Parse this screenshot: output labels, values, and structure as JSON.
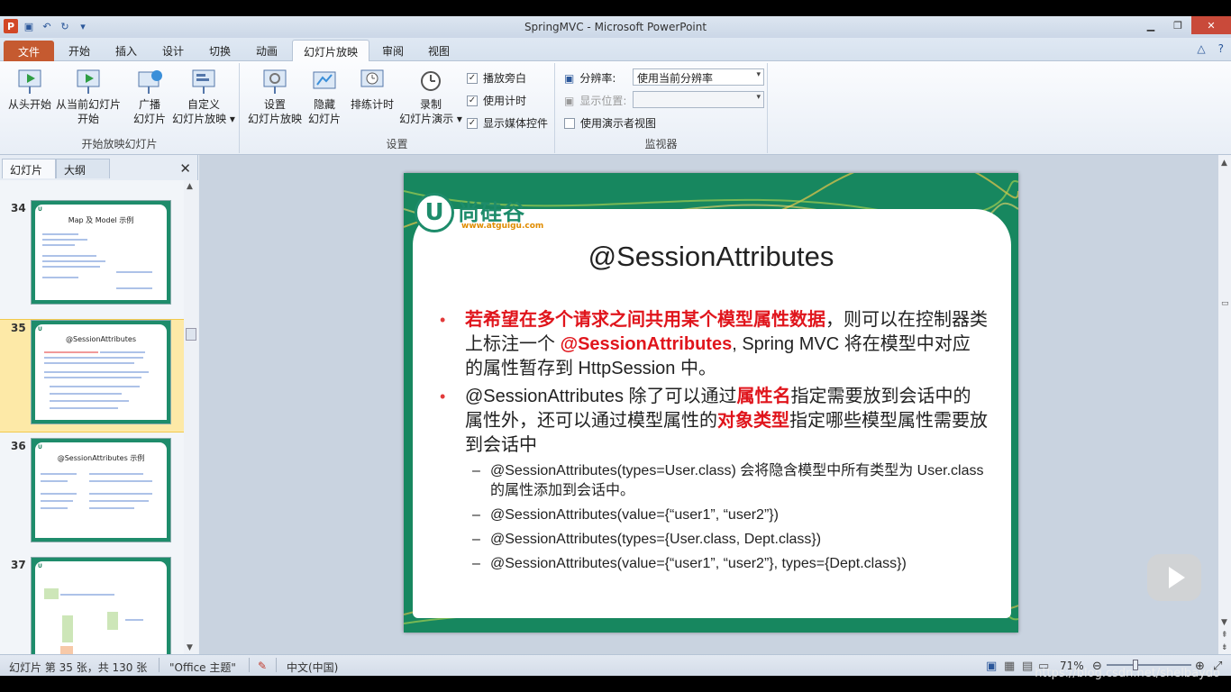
{
  "app": {
    "title": "SpringMVC  -  Microsoft PowerPoint",
    "qat_icons": [
      "powerpoint-icon",
      "save-icon",
      "undo-icon",
      "redo-icon",
      "customize-icon"
    ]
  },
  "tabs": [
    "文件",
    "开始",
    "插入",
    "设计",
    "切换",
    "动画",
    "幻灯片放映",
    "审阅",
    "视图"
  ],
  "ribbon": {
    "group1": {
      "label": "开始放映幻灯片",
      "btn1": "从头开始",
      "btn2_l1": "从当前幻灯片",
      "btn2_l2": "开始",
      "btn3_l1": "广播",
      "btn3_l2": "幻灯片",
      "btn4_l1": "自定义",
      "btn4_l2": "幻灯片放映 ▾"
    },
    "group2": {
      "label": "设置",
      "btn1_l1": "设置",
      "btn1_l2": "幻灯片放映",
      "btn2_l1": "隐藏",
      "btn2_l2": "幻灯片",
      "btn3": "排练计时",
      "btn4_l1": "录制",
      "btn4_l2": "幻灯片演示 ▾",
      "chk1": "播放旁白",
      "chk2": "使用计时",
      "chk3": "显示媒体控件"
    },
    "group3": {
      "label": "监视器",
      "resolution_label": "分辨率:",
      "resolution_value": "使用当前分辨率",
      "display_label": "显示位置:",
      "presenter": "使用演示者视图"
    }
  },
  "pane": {
    "tab_slides": "幻灯片",
    "tab_outline": "大纲",
    "close": "✕",
    "thumbs": [
      {
        "num": "34",
        "title": "Map 及 Model 示例"
      },
      {
        "num": "35",
        "title": "@SessionAttributes"
      },
      {
        "num": "36",
        "title": "@SessionAttributes 示例"
      },
      {
        "num": "37",
        "title": ""
      }
    ]
  },
  "slide": {
    "logo_letter": "U",
    "logo_name": "尚硅谷",
    "logo_url": "www.atguigu.com",
    "title": "@SessionAttributes",
    "p1_red": "若希望在多个请求之间共用某个模型属性数据",
    "p1_a": "，则可以在控制器类上标注一个 ",
    "p1_red2": "@SessionAttributes",
    "p1_b": ", Spring MVC 将在模型中对应的属性暂存到 HttpSession 中。",
    "p2_a": "@SessionAttributes 除了可以通过",
    "p2_red": "属性名",
    "p2_b": "指定需要放到会话中的属性外，还可以通过模型属性的",
    "p2_red2": "对象类型",
    "p2_c": "指定哪些模型属性需要放到会话中",
    "s1": "@SessionAttributes(types=User.class) 会将隐含模型中所有类型为 User.class 的属性添加到会话中。",
    "s2": "@SessionAttributes(value={“user1”, “user2”})",
    "s3": "@SessionAttributes(types={User.class, Dept.class})",
    "s4": "@SessionAttributes(value={“user1”, “user2”}, types={Dept.class})"
  },
  "status": {
    "slide_info": "幻灯片 第 35 张，共 130 张",
    "theme": "\"Office 主题\"",
    "language": "中文(中国)",
    "zoom": "71%"
  },
  "watermark": "https://blog.csdn.net/shelbaydo",
  "colors": {
    "accent": "#c55a30",
    "slide_green": "#17875f",
    "emphasis_red": "#e0151c"
  }
}
